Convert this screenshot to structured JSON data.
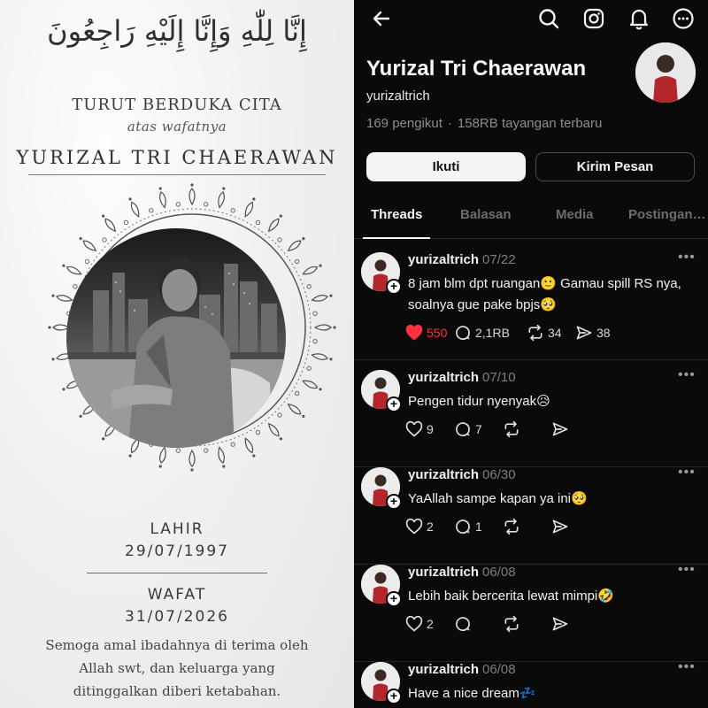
{
  "card": {
    "arabic": "إِنَّا لِلّٰهِ وَإِنَّا إِلَيْهِ رَاجِعُونَ",
    "title": "TURUT BERDUKA CITA",
    "subtitle": "atas wafatnya",
    "name": "YURIZAL TRI CHAERAWAN",
    "born_label": "LAHIR",
    "born_date": "29/07/1997",
    "died_label": "WAFAT",
    "died_date": "31/07/2026",
    "prayer": "Semoga amal ibadahnya di terima oleh Allah swt, dan keluarga yang ditinggalkan diberi ketabahan."
  },
  "app": {
    "icons": [
      "back-arrow-icon",
      "search-icon",
      "instagram-icon",
      "notification-bell-icon",
      "more-menu-icon"
    ],
    "profile": {
      "name": "Yurizal Tri Chaerawan",
      "handle": "yurizaltrich",
      "followers": "169 pengikut",
      "views": "158RB tayangan terbaru"
    },
    "buttons": {
      "follow": "Ikuti",
      "message": "Kirim Pesan"
    },
    "tabs": [
      "Threads",
      "Balasan",
      "Media",
      "Postingan…"
    ],
    "active_tab": "Threads",
    "posts": [
      {
        "author": "yurizaltrich",
        "date": "07/22",
        "text": "8 jam blm dpt ruangan🙂 Gamau spill RS nya, soalnya gue pake bpjs🥺",
        "likes": "550",
        "liked": true,
        "comments": "2,1RB",
        "reposts": "34",
        "shares": "38"
      },
      {
        "author": "yurizaltrich",
        "date": "07/10",
        "text": "Pengen tidur nyenyak😥",
        "likes": "9",
        "liked": false,
        "comments": "7",
        "reposts": "",
        "shares": ""
      },
      {
        "author": "yurizaltrich",
        "date": "06/30",
        "text": "YaAllah sampe kapan ya ini🥺",
        "likes": "2",
        "liked": false,
        "comments": "1",
        "reposts": "",
        "shares": ""
      },
      {
        "author": "yurizaltrich",
        "date": "06/08",
        "text": "Lebih baik bercerita lewat mimpi🤣",
        "likes": "2",
        "liked": false,
        "comments": "",
        "reposts": "",
        "shares": ""
      },
      {
        "author": "yurizaltrich",
        "date": "06/08",
        "text": "Have a nice dream💤",
        "likes": "",
        "liked": false,
        "comments": "",
        "reposts": "",
        "shares": ""
      }
    ],
    "colors": {
      "background": "#0a0a0a",
      "like": "#ff3040",
      "muted": "#7e7e7e"
    }
  }
}
